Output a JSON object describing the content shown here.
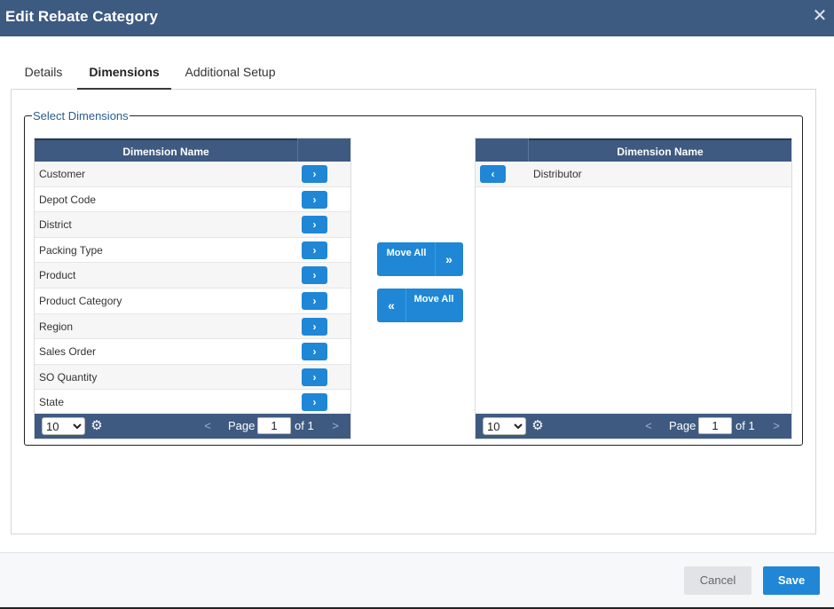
{
  "dialog": {
    "title": "Edit Rebate Category",
    "close_icon": "close-icon"
  },
  "tabs": [
    {
      "label": "Details",
      "active": false
    },
    {
      "label": "Dimensions",
      "active": true
    },
    {
      "label": "Additional Setup",
      "active": false
    }
  ],
  "fieldset": {
    "legend": "Select Dimensions"
  },
  "available_grid": {
    "column_header": "Dimension Name",
    "rows": [
      {
        "name": "Customer"
      },
      {
        "name": "Depot Code"
      },
      {
        "name": "District"
      },
      {
        "name": "Packing Type"
      },
      {
        "name": "Product"
      },
      {
        "name": "Product Category"
      },
      {
        "name": "Region"
      },
      {
        "name": "Sales Order"
      },
      {
        "name": "SO Quantity"
      },
      {
        "name": "State"
      }
    ],
    "row_button_icon": "chevron-right-icon",
    "page_size": "10",
    "page_size_options": [
      "10"
    ],
    "page_label": "Page",
    "page_value": "1",
    "page_of": "of 1",
    "prev_glyph": "<",
    "next_glyph": ">"
  },
  "selected_grid": {
    "column_header": "Dimension Name",
    "rows": [
      {
        "name": "Distributor"
      }
    ],
    "row_button_icon": "chevron-left-icon",
    "page_size": "10",
    "page_size_options": [
      "10"
    ],
    "page_label": "Page",
    "page_value": "1",
    "page_of": "of 1",
    "prev_glyph": "<",
    "next_glyph": ">"
  },
  "move_all_right": {
    "label": "Move All",
    "icon": "double-chevron-right-icon"
  },
  "move_all_left": {
    "label": "Move All",
    "icon": "double-chevron-left-icon"
  },
  "footer": {
    "cancel_label": "Cancel",
    "save_label": "Save"
  },
  "colors": {
    "title_bar": "#3d5a80",
    "grid_header": "#3e5a81",
    "accent_button": "#1f87d6",
    "legend_text": "#2a5d8f"
  }
}
